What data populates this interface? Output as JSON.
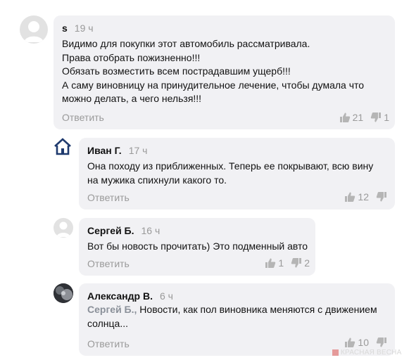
{
  "comments": [
    {
      "author": "s",
      "time": "19 ч",
      "lines": [
        "Видимо для покупки этот автомобиль рассматривала.",
        "Права отобрать пожизненно!!!",
        "Обязать возместить всем пострадавшим ущерб!!!",
        "А саму виновницу на принудительное лечение, чтобы думала что",
        "можно делать, а чего нельзя!!!"
      ],
      "reply_label": "Ответить",
      "likes": "21",
      "dislikes": "1",
      "avatar_icon": "default-avatar-icon"
    },
    {
      "author": "Иван Г.",
      "time": "17 ч",
      "lines": [
        "Она походу из приближенных. Теперь ее покрывают, всю вину",
        "на мужика спихнули какого то."
      ],
      "reply_label": "Ответить",
      "likes": "12",
      "dislikes": "",
      "avatar_icon": "house-icon"
    },
    {
      "author": "Сергей Б.",
      "time": "16 ч",
      "lines": [
        "Вот бы новость прочитать) Это подменный авто"
      ],
      "reply_label": "Ответить",
      "likes": "1",
      "dislikes": "2",
      "avatar_icon": "default-avatar-icon"
    },
    {
      "author": "Александр В.",
      "time": "6 ч",
      "reply_to": "Сергей Б.,",
      "lines": [
        " Новости, как  пол виновника меняются с движением",
        "солнца..."
      ],
      "reply_label": "Ответить",
      "likes": "10",
      "dislikes": "",
      "avatar_icon": "photo-avatar"
    }
  ],
  "watermark": "КРАСНАЯ ВЕСНА",
  "colors": {
    "bubble": "#f1f1f4",
    "muted": "#9a9a9a",
    "house_icon": "#1f3a6e"
  }
}
